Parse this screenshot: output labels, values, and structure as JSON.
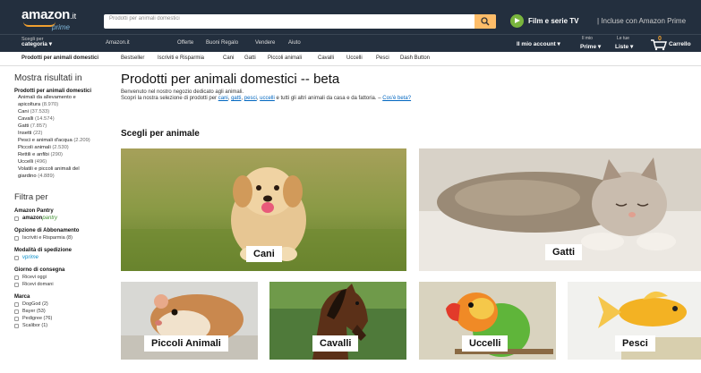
{
  "header": {
    "logo_text": "amazon",
    "logo_suffix": ".it",
    "logo_prime": "prime",
    "search_placeholder": "Prodotti per animali domestici",
    "prime_video_title": "Film e serie TV",
    "prime_video_sub": "| Incluse con Amazon Prime"
  },
  "nav2": {
    "cat_small": "Scegli per",
    "cat_big": "categoria",
    "links": [
      "Amazon.it",
      "Offerte",
      "Buoni Regalo",
      "Vendere",
      "Aiuto"
    ],
    "account": "Il mio account",
    "prime_small": "Il mio",
    "prime_big": "Prime",
    "lists_small": "Le tue",
    "lists_big": "Liste",
    "cart": "Carrello",
    "cart_count": "0"
  },
  "subnav": [
    "Prodotti per animali domestici",
    "Bestseller",
    "Iscriviti e Risparmia",
    "Cani",
    "Gatti",
    "Piccoli animali",
    "Cavalli",
    "Uccelli",
    "Pesci",
    "Dash Button"
  ],
  "sidebar": {
    "results_title": "Mostra risultati in",
    "root": "Prodotti per animali domestici",
    "categories": [
      {
        "label": "Animali da allevamento e",
        "count": ""
      },
      {
        "label": "apicoltura",
        "count": "(8.970)"
      },
      {
        "label": "Cani",
        "count": "(37.533)"
      },
      {
        "label": "Cavalli",
        "count": "(14.574)"
      },
      {
        "label": "Gatti",
        "count": "(7.857)"
      },
      {
        "label": "Insetti",
        "count": "(22)"
      },
      {
        "label": "Pesci e animali d'acqua",
        "count": "(2.209)"
      },
      {
        "label": "Piccoli animali",
        "count": "(2.530)"
      },
      {
        "label": "Rettili e anfibi",
        "count": "(290)"
      },
      {
        "label": "Uccelli",
        "count": "(496)"
      },
      {
        "label": "Volatili e piccoli animali del",
        "count": ""
      },
      {
        "label": "giardino",
        "count": "(4.889)"
      }
    ],
    "filter_title": "Filtra per",
    "pantry_section": "Amazon Pantry",
    "pantry_label": "amazon",
    "pantry_suffix": "pantry",
    "subscription_section": "Opzione di Abbonamento",
    "subscription_option": "Iscriviti e Risparmia (8)",
    "shipping_section": "Modalità di spedizione",
    "shipping_option": "vprime",
    "delivery_section": "Giorno di consegna",
    "delivery_options": [
      "Ricevi oggi",
      "Ricevi domani"
    ],
    "brand_section": "Marca",
    "brands": [
      "DogGod (2)",
      "Bayer (53)",
      "Pedigree (76)",
      "Scalibor (1)"
    ]
  },
  "main": {
    "title": "Prodotti per animali domestici -- beta",
    "intro1": "Benvenuto nel nostro negozio dedicato agli animali.",
    "intro2_prefix": "Scopri la nostra selezione di prodotti per ",
    "intro2_links": [
      "cani",
      "gatti",
      "pesci",
      "uccelli"
    ],
    "intro2_suffix": " e tutti gli altri animali da casa e da fattoria. –",
    "intro2_beta": "Cos'è beta?",
    "section_title": "Scegli per animale",
    "tiles": [
      "Cani",
      "Gatti",
      "Piccoli Animali",
      "Cavalli",
      "Uccelli",
      "Pesci"
    ]
  }
}
